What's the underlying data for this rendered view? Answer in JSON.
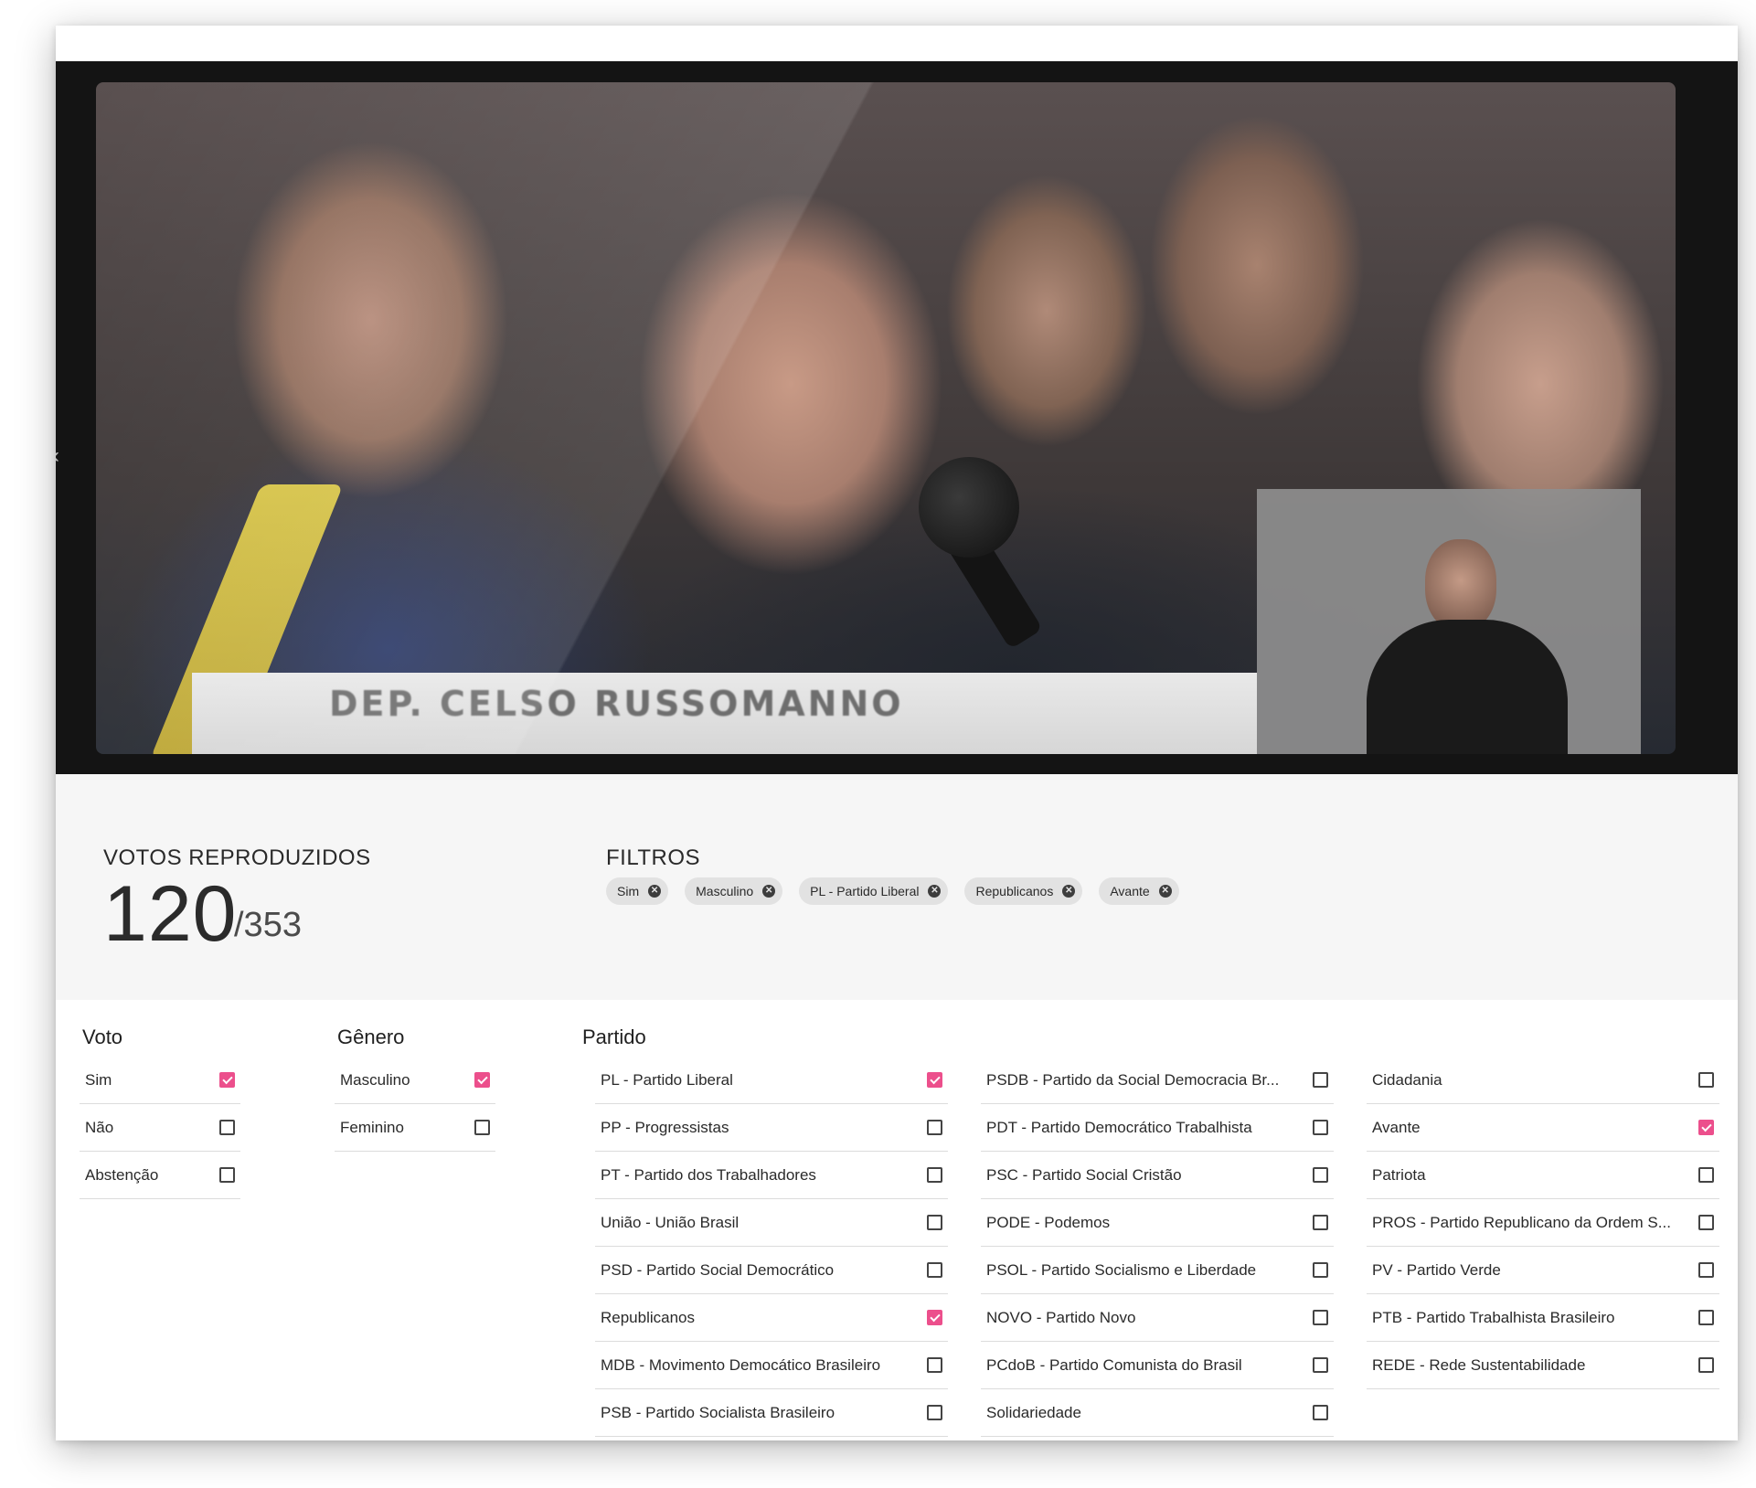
{
  "video": {
    "lower_third": "DEP. CELSO RUSSOMANNO",
    "prev_icon": "chevron-left-icon"
  },
  "stats": {
    "label": "VOTOS REPRODUZIDOS",
    "count": "120",
    "total": "/353"
  },
  "filters": {
    "label": "FILTROS",
    "chips": [
      "Sim",
      "Masculino",
      "PL - Partido Liberal",
      "Republicanos",
      "Avante"
    ]
  },
  "accent_color": "#ec4f8c",
  "voto": {
    "title": "Voto",
    "items": [
      {
        "label": "Sim",
        "checked": true
      },
      {
        "label": "Não",
        "checked": false
      },
      {
        "label": "Abstenção",
        "checked": false
      }
    ]
  },
  "genero": {
    "title": "Gênero",
    "items": [
      {
        "label": "Masculino",
        "checked": true
      },
      {
        "label": "Feminino",
        "checked": false
      }
    ]
  },
  "partido": {
    "title": "Partido",
    "columns": [
      [
        {
          "label": "PL - Partido Liberal",
          "checked": true
        },
        {
          "label": "PP - Progressistas",
          "checked": false
        },
        {
          "label": "PT - Partido dos Trabalhadores",
          "checked": false
        },
        {
          "label": "União - União Brasil",
          "checked": false
        },
        {
          "label": "PSD - Partido Social Democrático",
          "checked": false
        },
        {
          "label": "Republicanos",
          "checked": true
        },
        {
          "label": "MDB - Movimento Democático Brasileiro",
          "checked": false
        },
        {
          "label": "PSB - Partido Socialista Brasileiro",
          "checked": false
        }
      ],
      [
        {
          "label": "PSDB - Partido da Social Democracia Br...",
          "checked": false
        },
        {
          "label": "PDT - Partido Democrático Trabalhista",
          "checked": false
        },
        {
          "label": "PSC - Partido Social Cristão",
          "checked": false
        },
        {
          "label": "PODE - Podemos",
          "checked": false
        },
        {
          "label": "PSOL - Partido Socialismo e Liberdade",
          "checked": false
        },
        {
          "label": "NOVO - Partido Novo",
          "checked": false
        },
        {
          "label": "PCdoB - Partido Comunista do Brasil",
          "checked": false
        },
        {
          "label": "Solidariedade",
          "checked": false
        }
      ],
      [
        {
          "label": "Cidadania",
          "checked": false
        },
        {
          "label": "Avante",
          "checked": true
        },
        {
          "label": "Patriota",
          "checked": false
        },
        {
          "label": "PROS - Partido Republicano da Ordem S...",
          "checked": false
        },
        {
          "label": "PV - Partido Verde",
          "checked": false
        },
        {
          "label": "PTB - Partido Trabalhista Brasileiro",
          "checked": false
        },
        {
          "label": "REDE - Rede Sustentabilidade",
          "checked": false
        }
      ]
    ]
  }
}
